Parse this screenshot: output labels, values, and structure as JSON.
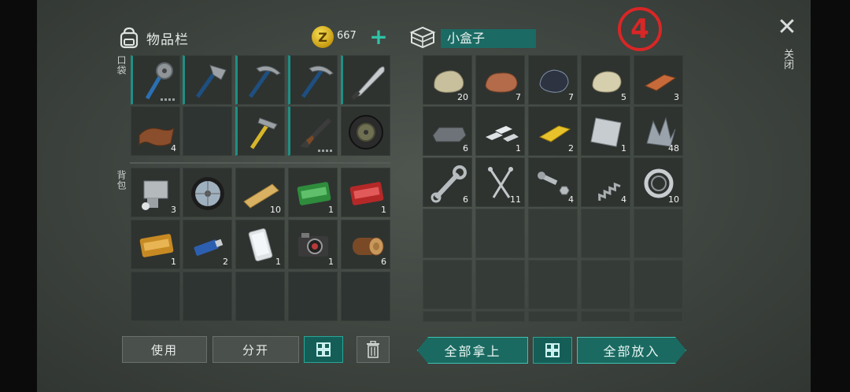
{
  "inventory": {
    "title": "物品栏",
    "coins": "667",
    "pocket_label": "口袋",
    "backpack_label": "背包",
    "pocket": [
      {
        "name": "saw-mace-icon",
        "count": "",
        "dots": true
      },
      {
        "name": "hatchet-icon",
        "count": ""
      },
      {
        "name": "pickaxe-icon",
        "count": ""
      },
      {
        "name": "pickaxe-icon",
        "count": ""
      },
      {
        "name": "machete-icon",
        "count": ""
      },
      {
        "name": "leather-icon",
        "count": "4"
      },
      {
        "name": "",
        "count": ""
      },
      {
        "name": "hammer-icon",
        "count": ""
      },
      {
        "name": "shotgun-icon",
        "count": "",
        "dots": true
      },
      {
        "name": "tire-disc-icon",
        "count": ""
      }
    ],
    "backpack": [
      {
        "name": "engine-part-icon",
        "count": "3"
      },
      {
        "name": "wheel-icon",
        "count": ""
      },
      {
        "name": "plank-icon",
        "count": "10"
      },
      {
        "name": "ration-coupon-icon",
        "count": "1"
      },
      {
        "name": "red-coupon-icon",
        "count": "1"
      },
      {
        "name": "survival-coupon-icon",
        "count": "1"
      },
      {
        "name": "usb-drive-icon",
        "count": "2"
      },
      {
        "name": "phone-icon",
        "count": "1"
      },
      {
        "name": "camera-icon",
        "count": "1"
      },
      {
        "name": "log-icon",
        "count": "6"
      },
      {
        "name": "",
        "count": ""
      },
      {
        "name": "",
        "count": ""
      },
      {
        "name": "",
        "count": ""
      },
      {
        "name": "",
        "count": ""
      },
      {
        "name": "",
        "count": ""
      }
    ]
  },
  "box": {
    "title": "小盒子",
    "items": [
      {
        "name": "stone-icon",
        "count": "20"
      },
      {
        "name": "iron-ore-icon",
        "count": "7"
      },
      {
        "name": "coal-ore-icon",
        "count": "7"
      },
      {
        "name": "limestone-icon",
        "count": "5"
      },
      {
        "name": "copper-ingot-icon",
        "count": "3"
      },
      {
        "name": "iron-ingot-icon",
        "count": "6"
      },
      {
        "name": "silver-bars-icon",
        "count": "1"
      },
      {
        "name": "gold-bar-icon",
        "count": "2"
      },
      {
        "name": "metal-sheet-icon",
        "count": "1"
      },
      {
        "name": "scrap-metal-icon",
        "count": "48"
      },
      {
        "name": "wrench-icon",
        "count": "6"
      },
      {
        "name": "nails-icon",
        "count": "11"
      },
      {
        "name": "bolt-nut-icon",
        "count": "4"
      },
      {
        "name": "spring-icon",
        "count": "4"
      },
      {
        "name": "bearing-icon",
        "count": "10"
      }
    ]
  },
  "step_marker": "4",
  "close": {
    "symbol": "✕",
    "label": "关闭"
  },
  "buttons": {
    "use": "使用",
    "split": "分开",
    "take_all": "全部拿上",
    "put_all": "全部放入"
  }
}
